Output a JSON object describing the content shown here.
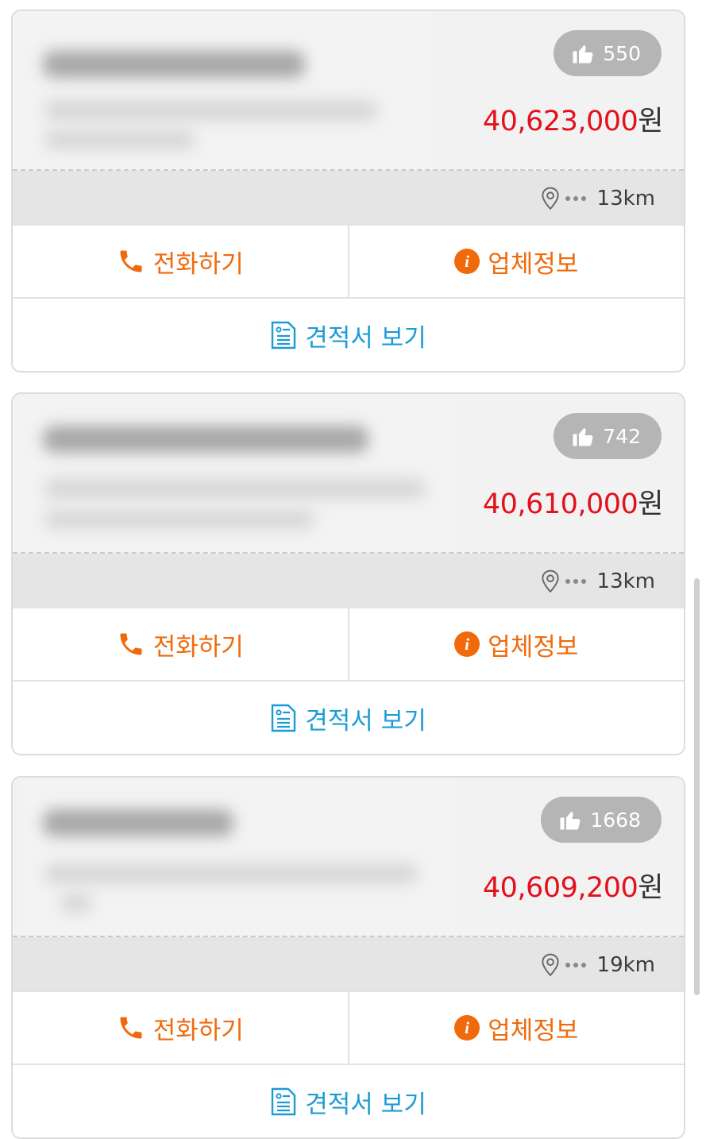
{
  "listings": [
    {
      "likes": "550",
      "price": "40,623,000",
      "price_unit": "원",
      "distance": "13km",
      "call_label": "전화하기",
      "info_label": "업체정보",
      "quote_label": "견적서 보기"
    },
    {
      "likes": "742",
      "price": "40,610,000",
      "price_unit": "원",
      "distance": "13km",
      "call_label": "전화하기",
      "info_label": "업체정보",
      "quote_label": "견적서 보기"
    },
    {
      "likes": "1668",
      "price": "40,609,200",
      "price_unit": "원",
      "distance": "19km",
      "call_label": "전화하기",
      "info_label": "업체정보",
      "quote_label": "견적서 보기"
    }
  ],
  "icons": {
    "like": "thumbs-up-icon",
    "location": "map-pin-icon",
    "call": "phone-icon",
    "info": "info-icon",
    "quote": "document-icon"
  },
  "colors": {
    "price": "#e3101d",
    "action": "#f06a0c",
    "quote": "#1d9bd6",
    "badge": "#b5b5b5"
  }
}
